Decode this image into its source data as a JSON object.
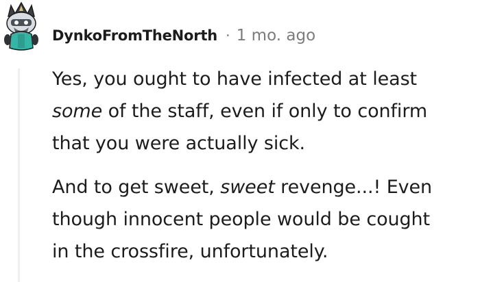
{
  "comment": {
    "username": "DynkoFromTheNorth",
    "separator": "·",
    "timestamp": "1 mo. ago",
    "avatar_icon": "snoo-avatar-icon",
    "paragraphs": [
      {
        "lines": [
          [
            {
              "text": "Yes, you ought to have infected at least"
            }
          ],
          [
            {
              "text": "some",
              "italic": true
            },
            {
              "text": " of the staff, even if only to confirm"
            }
          ],
          [
            {
              "text": "that you were actually sick."
            }
          ]
        ]
      },
      {
        "lines": [
          [
            {
              "text": "And to get sweet, "
            },
            {
              "text": "sweet",
              "italic": true
            },
            {
              "text": " revenge...! Even"
            }
          ],
          [
            {
              "text": "though innocent people would be cought"
            }
          ],
          [
            {
              "text": "in the crossfire, unfortunately."
            }
          ]
        ]
      }
    ]
  },
  "colors": {
    "text": "#1c1c1c",
    "meta": "#7c7c7c",
    "thread_line": "#edeff1",
    "avatar_teal": "#34b5a5",
    "avatar_dark": "#2f3338"
  }
}
